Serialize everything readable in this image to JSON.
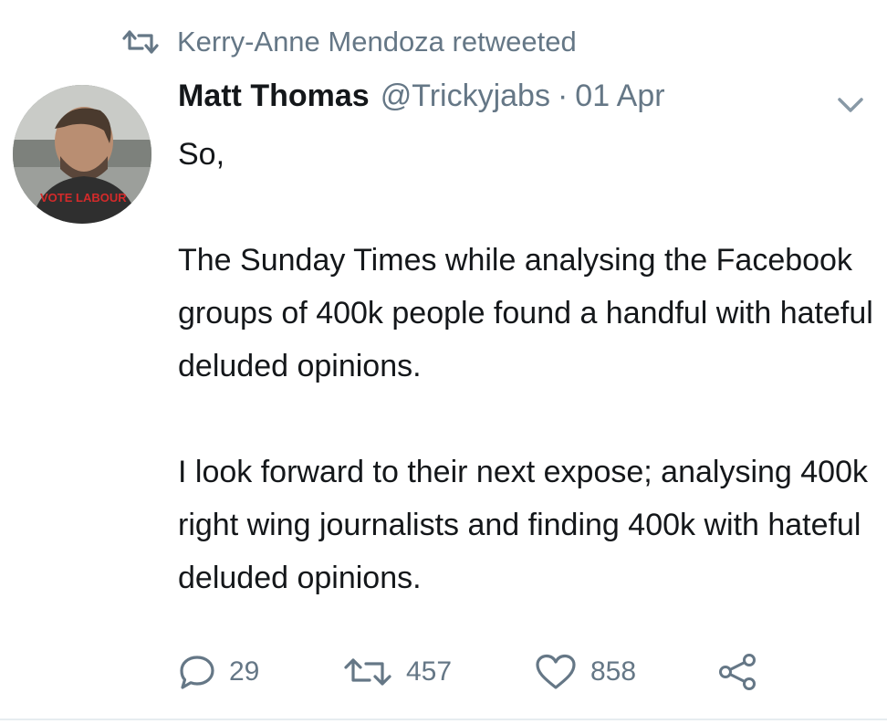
{
  "retweet_banner": {
    "text": "Kerry-Anne Mendoza retweeted"
  },
  "tweet": {
    "author_name": "Matt Thomas",
    "handle": "@Trickyjabs",
    "separator": "·",
    "date": "01 Apr",
    "avatar_caption": "VOTE LABOUR",
    "body": {
      "line1": "So,",
      "para2": "The Sunday Times while analysing the Facebook groups of 400k people found a handful with hateful deluded opinions.",
      "para3": "I look forward to their next expose; analysing 400k right wing journalists and finding 400k with hateful deluded opinions."
    },
    "stats": {
      "replies": "29",
      "retweets": "457",
      "likes": "858"
    }
  },
  "colors": {
    "text": "#14171a",
    "muted": "#657786",
    "divider": "#e6ecf0"
  },
  "icons": [
    "retweet-icon",
    "chevron-down-icon",
    "reply-icon",
    "heart-icon",
    "share-icon"
  ]
}
